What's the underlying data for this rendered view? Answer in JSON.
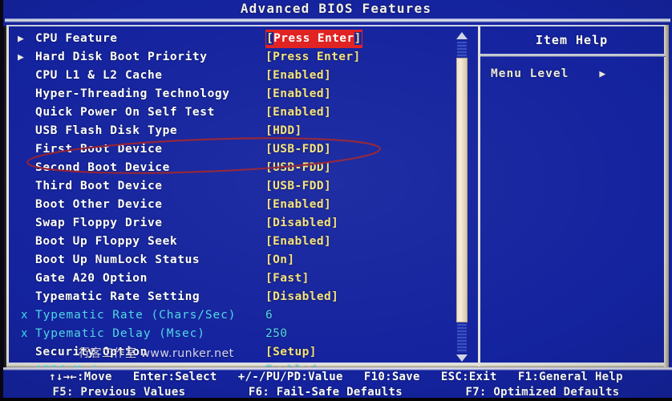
{
  "screen": {
    "title": "Advanced BIOS Features",
    "background_color": "#14239e",
    "value_color": "#f5e27a",
    "label_color": "#ffffff",
    "disabled_color": "#4fd8e4",
    "highlight_color": "#e02020"
  },
  "menu": {
    "rows": [
      {
        "marker": "▶",
        "label": "CPU Feature",
        "value": "[Press Enter]",
        "state": "selected"
      },
      {
        "marker": "▶",
        "label": "Hard Disk Boot Priority",
        "value": "[Press Enter]",
        "state": "normal"
      },
      {
        "marker": "",
        "label": "CPU L1 & L2 Cache",
        "value": "[Enabled]",
        "state": "normal"
      },
      {
        "marker": "",
        "label": "Hyper-Threading Technology",
        "value": "[Enabled]",
        "state": "normal"
      },
      {
        "marker": "",
        "label": "Quick Power On Self Test",
        "value": "[Enabled]",
        "state": "normal"
      },
      {
        "marker": "",
        "label": "USB Flash Disk Type",
        "value": "[HDD]",
        "state": "normal"
      },
      {
        "marker": "",
        "label": "First Boot Device",
        "value": "[USB-FDD]",
        "state": "normal"
      },
      {
        "marker": "",
        "label": "Second Boot Device",
        "value": "[USB-FDD]",
        "state": "normal"
      },
      {
        "marker": "",
        "label": "Third Boot Device",
        "value": "[USB-FDD]",
        "state": "normal"
      },
      {
        "marker": "",
        "label": "Boot Other Device",
        "value": "[Enabled]",
        "state": "normal"
      },
      {
        "marker": "",
        "label": "Swap Floppy Drive",
        "value": "[Disabled]",
        "state": "normal"
      },
      {
        "marker": "",
        "label": "Boot Up Floppy Seek",
        "value": "[Enabled]",
        "state": "normal"
      },
      {
        "marker": "",
        "label": "Boot Up NumLock Status",
        "value": "[On]",
        "state": "normal"
      },
      {
        "marker": "",
        "label": "Gate A20 Option",
        "value": "[Fast]",
        "state": "normal"
      },
      {
        "marker": "",
        "label": "Typematic Rate Setting",
        "value": "[Disabled]",
        "state": "normal"
      },
      {
        "marker": "x",
        "label": "Typematic Rate (Chars/Sec)",
        "value": "6",
        "state": "disabled"
      },
      {
        "marker": "x",
        "label": "Typematic Delay (Msec)",
        "value": "250",
        "state": "disabled"
      },
      {
        "marker": "",
        "label": "Security Option",
        "value": "[Setup]",
        "state": "normal"
      },
      {
        "marker": "x",
        "label": "APIC Mode",
        "value": "Enabled",
        "state": "disabled"
      }
    ]
  },
  "scrollbar": {
    "up_arrow": "▲",
    "down_arrow": "▼"
  },
  "item_help": {
    "title": "Item Help",
    "menu_level_label": "Menu Level",
    "menu_level_arrow": "▶"
  },
  "watermark": {
    "text": "行客工作室  www.runker.net"
  },
  "status_bar": {
    "line1": "↑↓→←:Move   Enter:Select   +/-/PU/PD:Value   F10:Save   ESC:Exit   F1:General Help",
    "line2": "F5: Previous Values         F6: Fail-Safe Defaults         F7: Optimized Defaults"
  },
  "annotation": {
    "type": "ellipse",
    "color": "#8f2036",
    "target": "First Boot Device"
  }
}
